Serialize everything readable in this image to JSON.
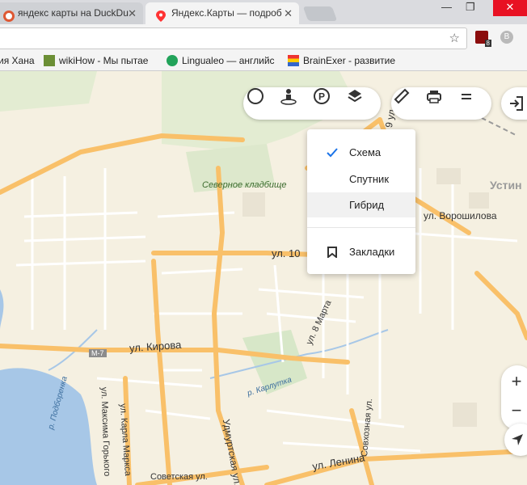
{
  "tabs": [
    {
      "title": "яндекс карты на DuckDu",
      "close": "✕"
    },
    {
      "title": "Яндекс.Карты — подроб",
      "close": "✕"
    }
  ],
  "window_controls": {
    "minimize": "—",
    "maximize": "❐",
    "close": "✕"
  },
  "bookmarks": [
    {
      "label": "ия Хана"
    },
    {
      "label": "wikiHow - Мы пытае"
    },
    {
      "label": "Lingualeo — английс"
    },
    {
      "label": "BrainExer - развитие"
    }
  ],
  "extension_badge": "8",
  "profile_letter": "B",
  "map_type_menu": {
    "items": [
      {
        "label": "Схема",
        "selected": true
      },
      {
        "label": "Спутник",
        "selected": false
      },
      {
        "label": "Гибрид",
        "selected": false
      }
    ],
    "bookmarks_label": "Закладки"
  },
  "map_labels": {
    "cemetery": "Северное кладбище",
    "street_10": "ул. 10",
    "district": "Устин",
    "voroshilova": "ул. Ворошилова",
    "kirova": "ул. Кирова",
    "m7": "М-7",
    "march8": "ул. 8 Марта",
    "karlutka": "р. Карлутка",
    "sovkhoznaya": "Совхозная ул.",
    "podborenka": "р. Подборенка",
    "maxima_gorkogo": "ул. Максима Горького",
    "karla_marksa": "ул. Карла Маркса",
    "udmurtskaya": "Удмуртская ул.",
    "sovetskaya": "Советская ул.",
    "lenina": "ул. Ленина",
    "vertical_9": "9 ул."
  },
  "zoom": {
    "plus": "+",
    "minus": "−"
  },
  "colors": {
    "road_major": "#f9c069",
    "road_minor": "#ffffff",
    "water": "#a7c7e7",
    "park": "#d7e7c8",
    "accent": "#1a73e8"
  }
}
